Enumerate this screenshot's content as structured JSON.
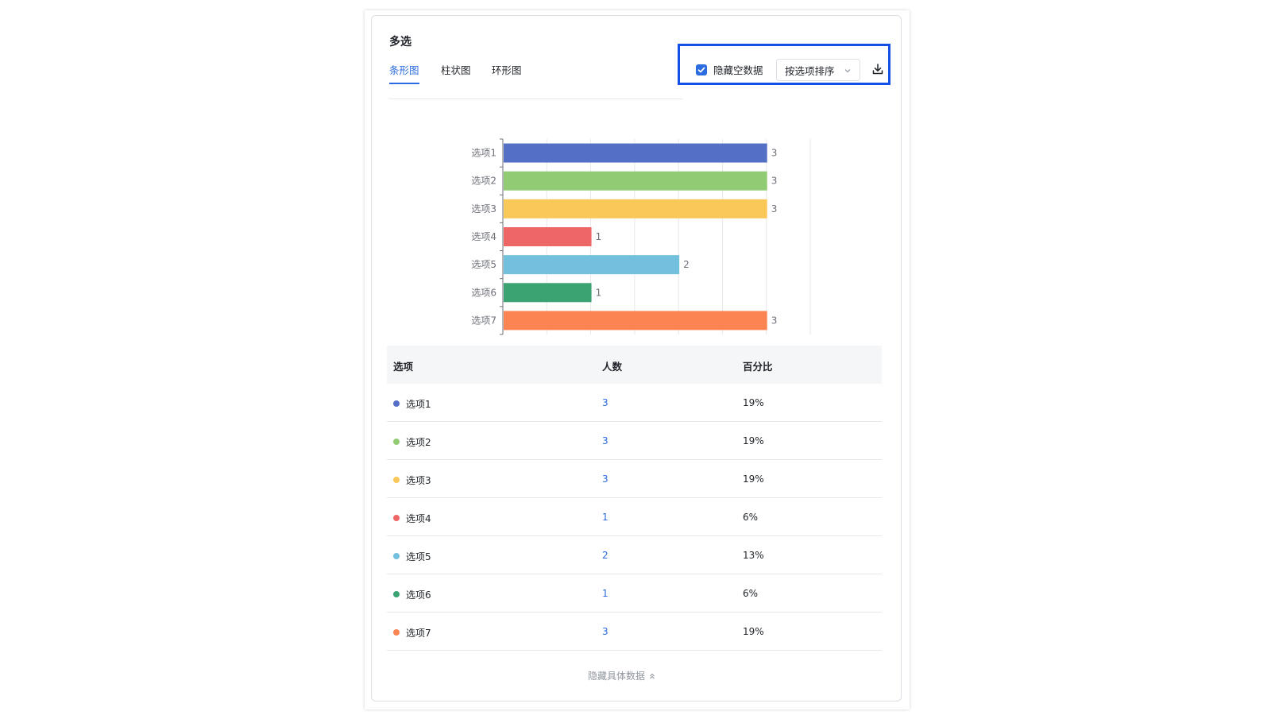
{
  "card": {
    "title": "多选"
  },
  "tabs": [
    {
      "label": "条形图",
      "active": true
    },
    {
      "label": "柱状图",
      "active": false
    },
    {
      "label": "环形图",
      "active": false
    }
  ],
  "toolbar": {
    "hide_empty_label": "隐藏空数据",
    "hide_empty_checked": true,
    "sort_select_value": "按选项排序",
    "download_icon": "download-icon",
    "highlight_color": "#1550e6"
  },
  "chart_data": {
    "type": "bar",
    "orientation": "horizontal",
    "categories": [
      "选项1",
      "选项2",
      "选项3",
      "选项4",
      "选项5",
      "选项6",
      "选项7"
    ],
    "values": [
      3,
      3,
      3,
      1,
      2,
      1,
      3
    ],
    "colors": [
      "#5470c6",
      "#91cc75",
      "#fac858",
      "#ee6666",
      "#73c0de",
      "#3ba272",
      "#fc8452"
    ],
    "xlim": [
      0,
      3.5
    ],
    "grid": true,
    "data_labels": true
  },
  "table": {
    "headers": [
      "选项",
      "人数",
      "百分比"
    ],
    "rows": [
      {
        "option": "选项1",
        "count": "3",
        "percent": "19%",
        "color": "#5470c6"
      },
      {
        "option": "选项2",
        "count": "3",
        "percent": "19%",
        "color": "#91cc75"
      },
      {
        "option": "选项3",
        "count": "3",
        "percent": "19%",
        "color": "#fac858"
      },
      {
        "option": "选项4",
        "count": "1",
        "percent": "6%",
        "color": "#ee6666"
      },
      {
        "option": "选项5",
        "count": "2",
        "percent": "13%",
        "color": "#73c0de"
      },
      {
        "option": "选项6",
        "count": "1",
        "percent": "6%",
        "color": "#3ba272"
      },
      {
        "option": "选项7",
        "count": "3",
        "percent": "19%",
        "color": "#fc8452"
      }
    ]
  },
  "footer": {
    "toggle_label": "隐藏具体数据"
  },
  "accent_color": "#2b6ce0"
}
